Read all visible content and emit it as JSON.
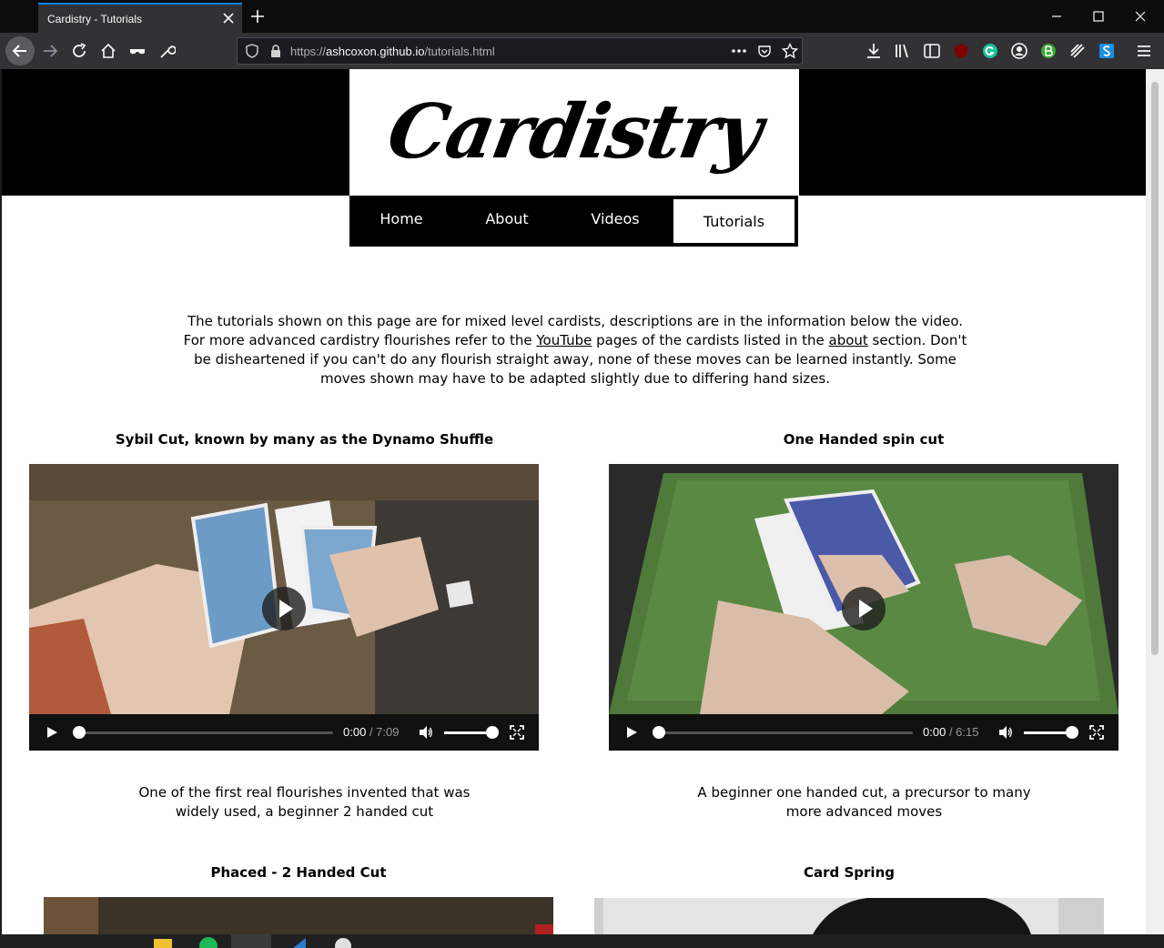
{
  "browser": {
    "tab_title": "Cardistry - Tutorials",
    "url_prefix": "https://",
    "url_host": "ashcoxon.github.io",
    "url_path": "/tutorials.html"
  },
  "site": {
    "logo": "Cardistry",
    "nav": [
      "Home",
      "About",
      "Videos",
      "Tutorials"
    ],
    "active_nav": "Tutorials"
  },
  "intro": {
    "part1": "The tutorials shown on this page are for mixed level cardists, descriptions are in the information below the video. For more advanced cardistry flourishes refer to the ",
    "link_youtube": "YouTube",
    "part2": " pages of the cardists listed in the ",
    "link_about": "about",
    "part3": " section. Don't be disheartened if you can't do any flourish straight away, none of these moves can be learned instantly. Some moves shown may have to be adapted slightly due to differing hand sizes."
  },
  "tutorials": [
    {
      "title": "Sybil Cut, known by many as the Dynamo Shuffle",
      "current": "0:00",
      "duration": "/ 7:09",
      "description": "One of the first real flourishes invented that was widely used, a beginner 2 handed cut"
    },
    {
      "title": "One Handed spin cut",
      "current": "0:00",
      "duration": "/ 6:15",
      "description": "A beginner one handed cut, a precursor to many more advanced moves"
    },
    {
      "title": "Phaced - 2 Handed Cut"
    },
    {
      "title": "Card Spring"
    }
  ]
}
